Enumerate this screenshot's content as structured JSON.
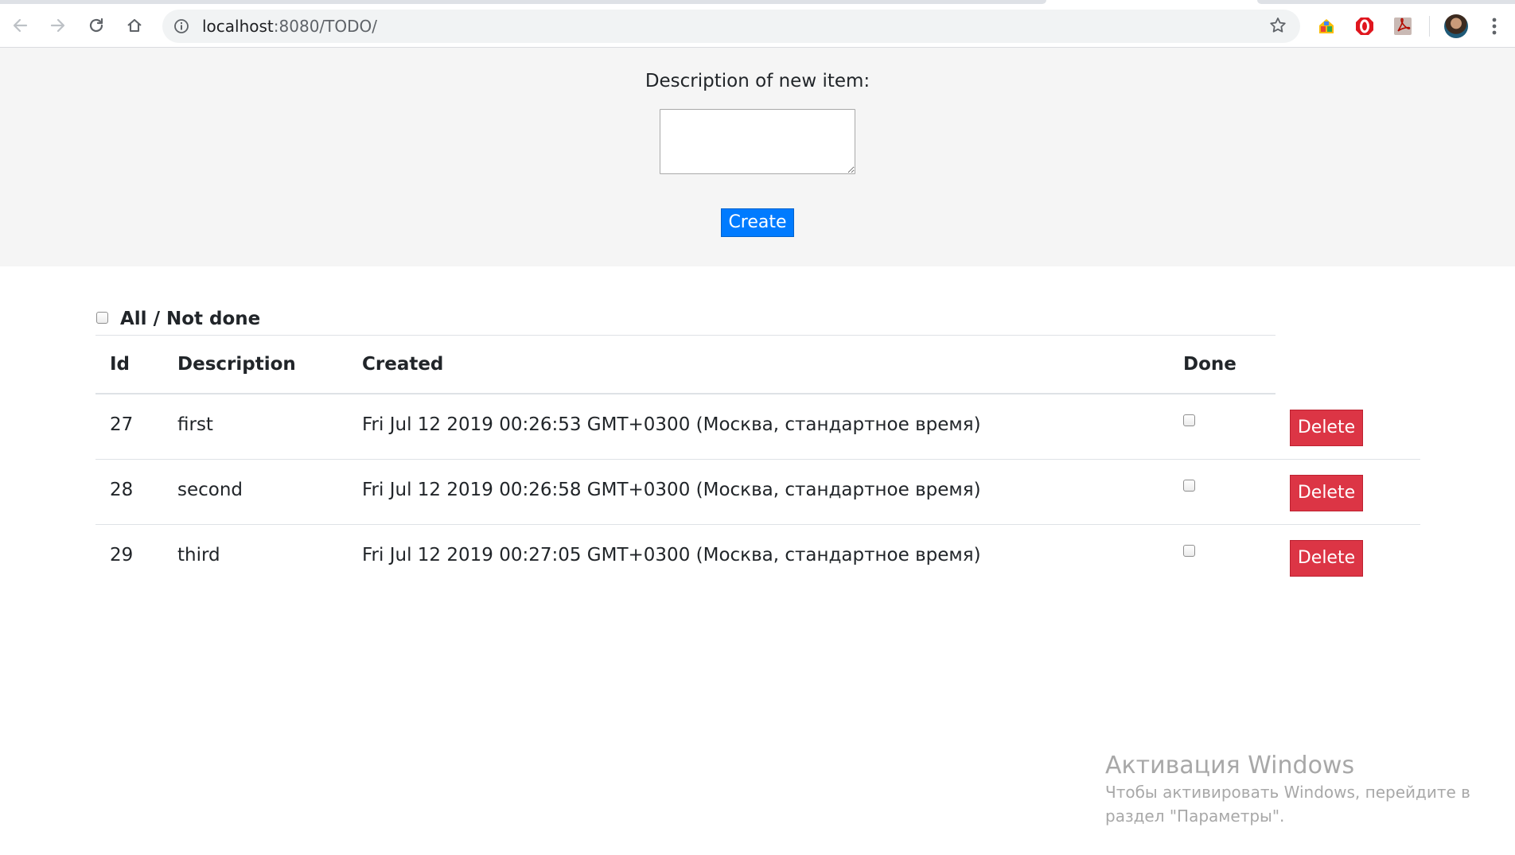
{
  "browser": {
    "url_host": "localhost",
    "url_rest": ":8080/TODO/",
    "back_icon": "arrow-left-icon",
    "forward_icon": "arrow-right-icon",
    "reload_icon": "reload-icon",
    "home_icon": "home-icon",
    "bookmark_icon": "star-icon",
    "extensions": [
      "google-apps-icon",
      "opera-adblock-icon",
      "pdf-reader-icon"
    ],
    "menu_icon": "more-vertical-icon"
  },
  "form": {
    "label": "Description of new item:",
    "textarea_value": "",
    "create_label": "Create"
  },
  "filter": {
    "label": "All / Not done",
    "checked": false
  },
  "table": {
    "columns": [
      "Id",
      "Description",
      "Created",
      "Done"
    ],
    "rows": [
      {
        "id": "27",
        "description": "first",
        "created": "Fri Jul 12 2019 00:26:53 GMT+0300 (Москва, стандартное время)",
        "done": false,
        "delete_label": "Delete"
      },
      {
        "id": "28",
        "description": "second",
        "created": "Fri Jul 12 2019 00:26:58 GMT+0300 (Москва, стандартное время)",
        "done": false,
        "delete_label": "Delete"
      },
      {
        "id": "29",
        "description": "third",
        "created": "Fri Jul 12 2019 00:27:05 GMT+0300 (Москва, стандартное время)",
        "done": false,
        "delete_label": "Delete"
      }
    ]
  },
  "watermark": {
    "title": "Активация Windows",
    "line1": "Чтобы активировать Windows, перейдите в",
    "line2": "раздел \"Параметры\"."
  },
  "colors": {
    "primary": "#007bff",
    "danger": "#dc3545",
    "form_background": "#f5f5f5"
  }
}
